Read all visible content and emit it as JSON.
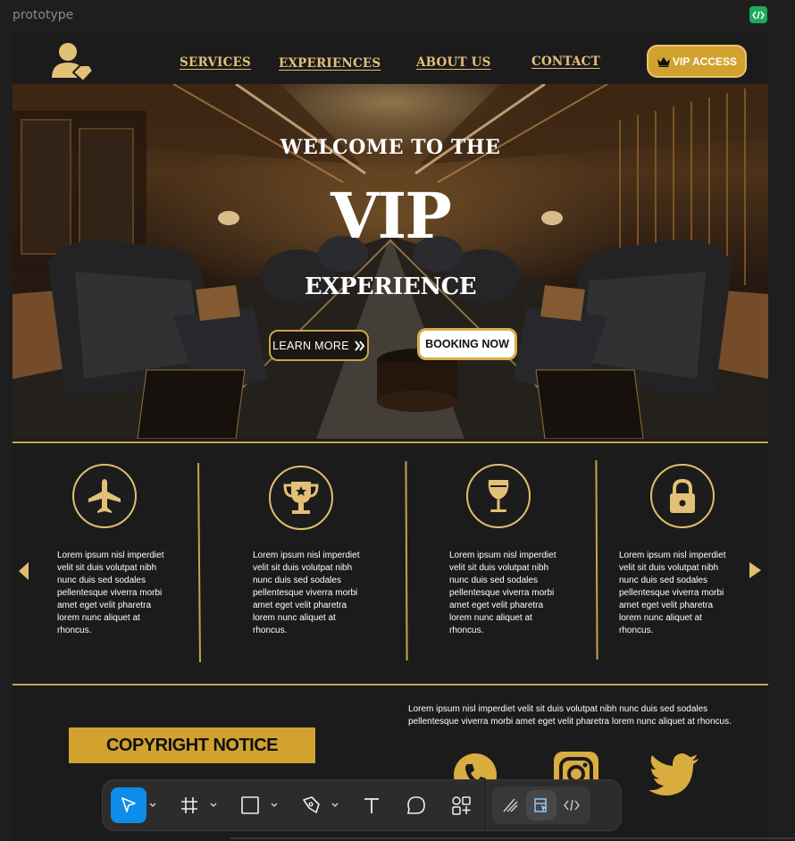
{
  "app": {
    "title": "prototype"
  },
  "nav": {
    "links": [
      "SERVICES",
      "EXPERIENCES",
      "ABOUT US",
      "CONTACT"
    ],
    "vip_label": "VIP ACCESS"
  },
  "hero": {
    "line1": "WELCOME TO THE",
    "line2": "VIP",
    "line3": "EXPERIENCE",
    "learn_label": "LEARN MORE",
    "booking_label": "BOOKING NOW"
  },
  "features": [
    {
      "icon": "airplane-icon",
      "text": "Lorem ipsum nisl imperdiet velit sit duis volutpat nibh nunc duis sed sodales pellentesque viverra morbi amet eget velit pharetra lorem nunc aliquet at rhoncus."
    },
    {
      "icon": "trophy-icon",
      "text": "Lorem ipsum nisl imperdiet velit sit duis volutpat nibh nunc duis sed sodales pellentesque viverra morbi amet eget velit pharetra lorem nunc aliquet at rhoncus."
    },
    {
      "icon": "wine-glass-icon",
      "text": "Lorem ipsum nisl imperdiet velit sit duis volutpat nibh nunc duis sed sodales pellentesque viverra morbi amet eget velit pharetra lorem nunc aliquet at rhoncus."
    },
    {
      "icon": "lock-icon",
      "text": "Lorem ipsum nisl imperdiet velit sit duis volutpat nibh nunc duis sed sodales pellentesque viverra morbi amet eget velit pharetra lorem nunc aliquet at rhoncus."
    }
  ],
  "footer": {
    "text": "Lorem ipsum nisl imperdiet velit sit duis volutpat nibh nunc duis sed sodales pellentesque viverra morbi amet eget velit pharetra lorem nunc aliquet at rhoncus.",
    "copyright_label": "COPYRIGHT NOTICE",
    "social_icons": [
      "phone-icon",
      "instagram-icon",
      "twitter-icon"
    ]
  },
  "toolbar": {
    "tools": [
      "move-tool",
      "frame-tool",
      "rectangle-tool",
      "pen-tool",
      "text-tool",
      "comment-tool",
      "components-tool"
    ],
    "mode_tools": [
      "draw-mode",
      "design-mode",
      "dev-mode"
    ],
    "active_tool": "move-tool",
    "active_mode": "design-mode"
  },
  "colors": {
    "gold": "#d2a22f",
    "gold_light": "#e3c078",
    "background": "#1b1b1b",
    "accent_blue": "#0d8ce9",
    "code_green": "#1faa5a"
  }
}
